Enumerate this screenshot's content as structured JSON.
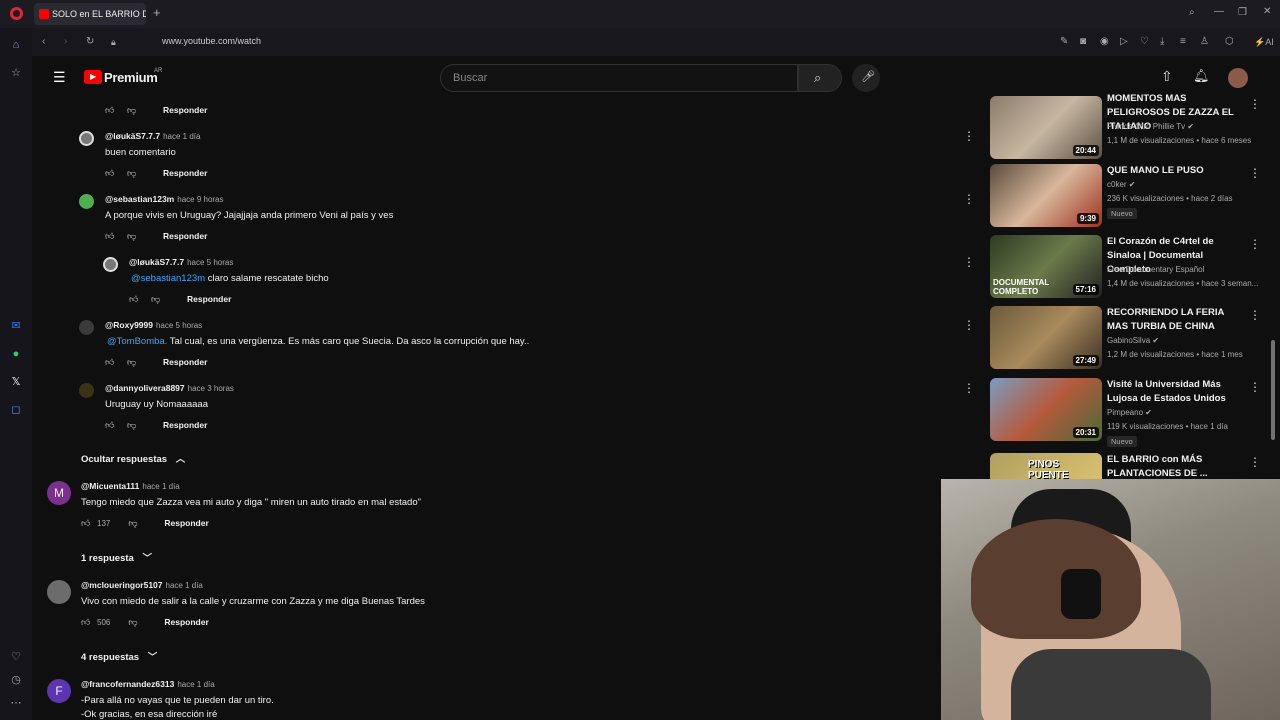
{
  "browser": {
    "tab_title": "SOLO en EL BARRIO DE L...",
    "url": "www.youtube.com/watch"
  },
  "youtube": {
    "logo_text": "Premium",
    "region": "AR",
    "search_placeholder": "Buscar"
  },
  "comments": [
    {
      "user": "@løukäS7.7.7",
      "time": "hace 1 día",
      "text": "buen comentario",
      "reply": "Responder"
    },
    {
      "user": "@sebastian123m",
      "time": "hace 9 horas",
      "text": "A porque vivis en Uruguay? Jajajjaja anda primero Veni al país y ves",
      "reply": "Responder"
    },
    {
      "user": "@løukäS7.7.7",
      "time": "hace 5 horas",
      "mention": "@sebastian123m",
      "text": "claro salame rescatate bicho",
      "reply": "Responder"
    },
    {
      "user": "@Roxy9999",
      "time": "hace 5 horas",
      "mention": "@TomBomba.",
      "text": " Tal cual, es una vergüenza. Es más caro que Suecia. Da asco la corrupción que hay..",
      "reply": "Responder"
    },
    {
      "user": "@dannyolivera8897",
      "time": "hace 3 horas",
      "text": "Uruguay uy Nomaaaaaa",
      "reply": "Responder"
    }
  ],
  "top_reply_label": "Responder",
  "hide_replies": "Ocultar respuestas",
  "top_comments": [
    {
      "user": "@Micuenta111",
      "time": "hace 1 día",
      "avatar_letter": "M",
      "text": "Tengo miedo que Zazza vea mi auto y diga \" miren un auto tirado en mal estado\"",
      "likes": "137",
      "reply": "Responder",
      "replies": "1 respuesta"
    },
    {
      "user": "@mcloueringor5107",
      "time": "hace 1 día",
      "text": "Vivo  con miedo de salir a la calle y cruzarme con Zazza y me diga Buenas Tardes",
      "likes": "506",
      "reply": "Responder",
      "replies": "4 respuestas"
    },
    {
      "user": "@francofernandez6313",
      "time": "hace 1 día",
      "avatar_letter": "F",
      "text_line1": "-Para allá no vayas que te pueden dar un tiro.",
      "text_line2": "-Ok gracias, en esa dirección iré"
    }
  ],
  "recommended": [
    {
      "title": "MOMENTOS MAS PELIGROSOS DE ZAZZA EL ITALIANO",
      "channel": "Prende Otro Phillie Tv",
      "meta": "1,1 M de visualizaciones • hace 6 meses",
      "duration": "20:44",
      "badge": ""
    },
    {
      "title": "QUE MANO LE PUSO",
      "channel": "c0ker",
      "meta": "236 K visualizaciones • hace 2 días",
      "duration": "9:39",
      "badge": "Nuevo"
    },
    {
      "title": "El Corazón de C4rtel de Sinaloa | Documental Completo",
      "channel": "Free Documentary Español",
      "meta": "1,4 M de visualizaciones • hace 3 seman...",
      "duration": "57:16",
      "badge": "",
      "thumb_text": "DOCUMENTAL COMPLETO"
    },
    {
      "title": "RECORRIENDO LA FERIA MAS TURBIA DE CHINA",
      "channel": "GabinoSilva",
      "meta": "1,2 M de visualizaciones • hace 1 mes",
      "duration": "27:49",
      "badge": ""
    },
    {
      "title": "Visité la Universidad Más Lujosa de Estados Unidos",
      "channel": "Pimpeano",
      "meta": "119 K visualizaciones • hace 1 día",
      "duration": "20:31",
      "badge": "Nuevo"
    },
    {
      "title": "EL BARRIO con MÁS PLANTACIONES DE ...",
      "channel": "",
      "meta": "",
      "duration": "",
      "badge": "",
      "thumb_text": "PINOS PUENTE"
    }
  ],
  "colors": {
    "accent": "#3ea6ff",
    "brand": "#ff0000",
    "background": "#0f0f0f"
  }
}
